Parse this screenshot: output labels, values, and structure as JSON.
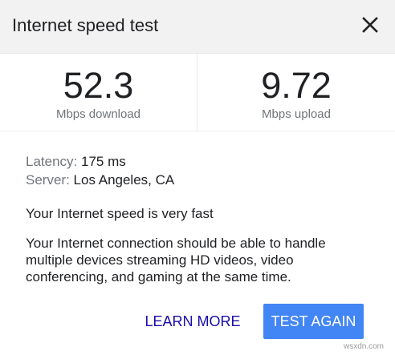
{
  "header": {
    "title": "Internet speed test",
    "close_icon": "close-icon"
  },
  "stats": {
    "download": {
      "value": "52.3",
      "label": "Mbps download"
    },
    "upload": {
      "value": "9.72",
      "label": "Mbps upload"
    }
  },
  "details": {
    "latency_key": "Latency:",
    "latency_value": "175 ms",
    "server_key": "Server:",
    "server_value": "Los Angeles, CA"
  },
  "result": {
    "verdict": "Your Internet speed is very fast",
    "description": "Your Internet connection should be able to handle multiple devices streaming HD videos, video conferencing, and gaming at the same time."
  },
  "actions": {
    "learn_more": "LEARN MORE",
    "test_again": "TEST AGAIN"
  },
  "watermark": "wsxdn.com",
  "colors": {
    "accent": "#4285f4",
    "link": "#1a0dab",
    "secondary_text": "#70757a",
    "header_bg": "#f2f2f2"
  }
}
